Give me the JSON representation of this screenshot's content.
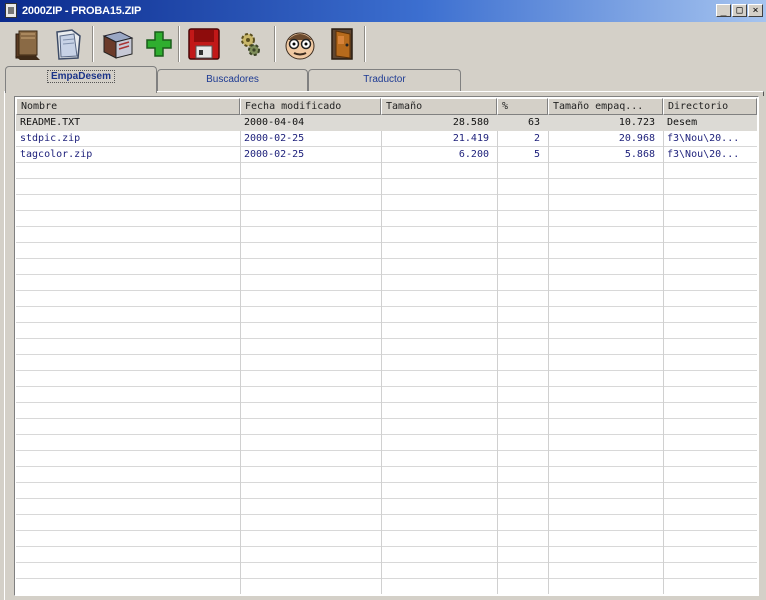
{
  "window": {
    "title": "2000ZIP - PROBA15.ZIP",
    "controls": {
      "minimize": "_",
      "maximize": "□",
      "close": "×"
    }
  },
  "toolbar": {
    "buttons": [
      {
        "icon": "book-open-icon"
      },
      {
        "icon": "folder-open-icon"
      },
      {
        "icon": "view-book-icon"
      },
      {
        "icon": "add-icon"
      },
      {
        "icon": "save-disk-icon"
      },
      {
        "icon": "gears-icon"
      },
      {
        "icon": "help-face-icon"
      },
      {
        "icon": "exit-door-icon"
      }
    ]
  },
  "tabs": [
    {
      "label": "EmpaDesem",
      "active": true
    },
    {
      "label": "Buscadores",
      "active": false
    },
    {
      "label": "Traductor",
      "active": false
    }
  ],
  "table": {
    "columns": [
      "Nombre",
      "Fecha modificado",
      "Tamaño",
      "%",
      "Tamaño empaq...",
      "Directorio"
    ],
    "rows": [
      {
        "name": "README.TXT",
        "date": "2000-04-04",
        "size": "28.580",
        "pct": "63",
        "packed": "10.723",
        "dir": "Desem",
        "selected": true
      },
      {
        "name": "stdpic.zip",
        "date": "2000-02-25",
        "size": "21.419",
        "pct": "2",
        "packed": "20.968",
        "dir": "f3\\Nou\\20...",
        "selected": false
      },
      {
        "name": "tagcolor.zip",
        "date": "2000-02-25",
        "size": "6.200",
        "pct": "5",
        "packed": "5.868",
        "dir": "f3\\Nou\\20...",
        "selected": false
      }
    ]
  },
  "colors": {
    "titlebar_start": "#0b2a8c",
    "titlebar_end": "#a6c4ef",
    "tab_text": "#1d3a93",
    "row_text": "#1c1f7a",
    "add_icon": "#2fae2f",
    "save_icon": "#c21818"
  }
}
